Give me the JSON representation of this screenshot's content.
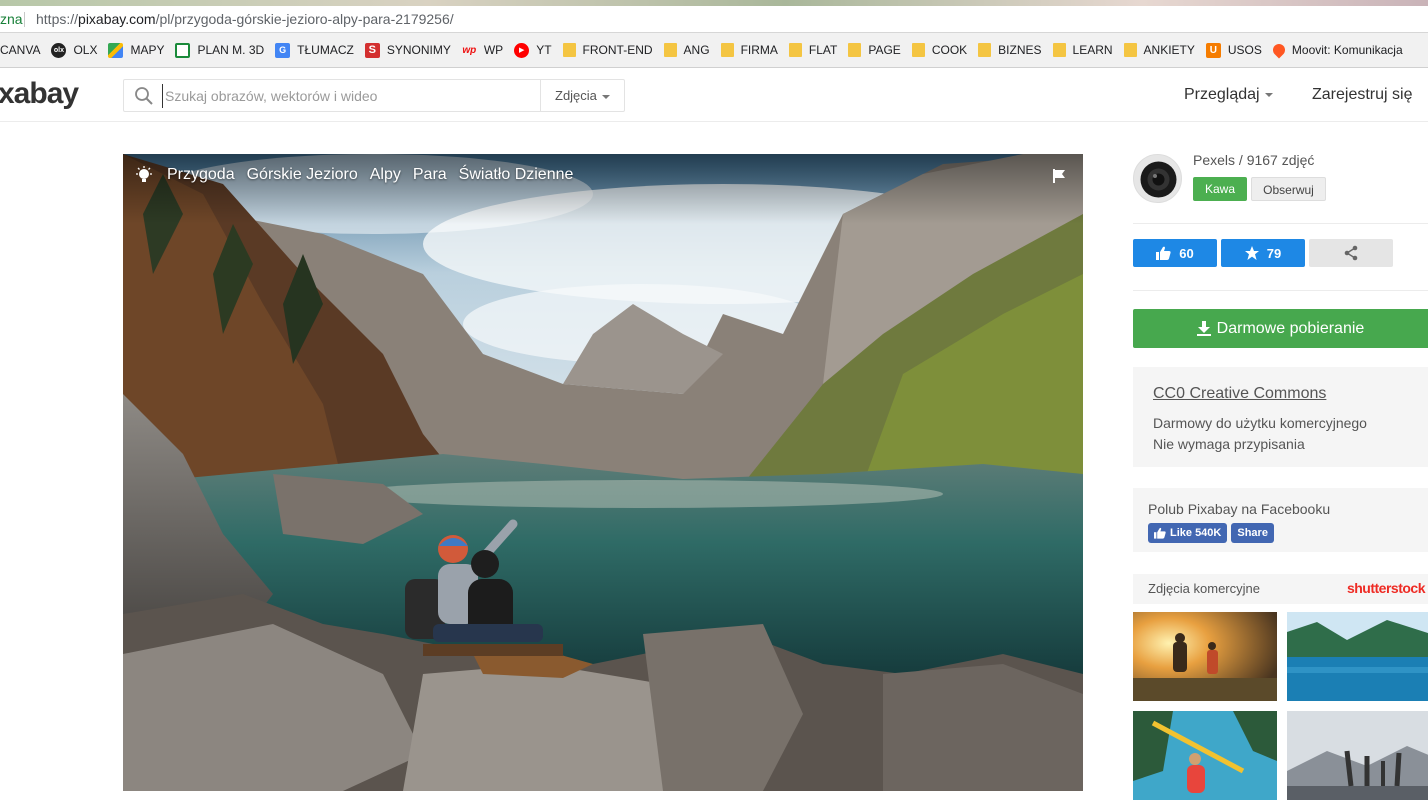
{
  "browser": {
    "url_fragment": "zna",
    "url_scheme": "https://",
    "url_host": "pixabay.com",
    "url_path": "/pl/przygoda-górskie-jezioro-alpy-para-2179256/"
  },
  "bookmarks": [
    {
      "label": "CANVA",
      "icon": "canva-icon"
    },
    {
      "label": "OLX",
      "icon": "olx-icon"
    },
    {
      "label": "MAPY",
      "icon": "maps-icon"
    },
    {
      "label": "PLAN M. 3D",
      "icon": "plan-icon"
    },
    {
      "label": "TŁUMACZ",
      "icon": "translate-icon"
    },
    {
      "label": "SYNONIMY",
      "icon": "synonyms-icon"
    },
    {
      "label": "WP",
      "icon": "wp-icon"
    },
    {
      "label": "YT",
      "icon": "youtube-icon"
    },
    {
      "label": "FRONT-END",
      "icon": "folder-icon"
    },
    {
      "label": "ANG",
      "icon": "folder-icon"
    },
    {
      "label": "FIRMA",
      "icon": "folder-icon"
    },
    {
      "label": "FLAT",
      "icon": "folder-icon"
    },
    {
      "label": "PAGE",
      "icon": "folder-icon"
    },
    {
      "label": "COOK",
      "icon": "folder-icon"
    },
    {
      "label": "BIZNES",
      "icon": "folder-icon"
    },
    {
      "label": "LEARN",
      "icon": "folder-icon"
    },
    {
      "label": "ANKIETY",
      "icon": "folder-icon"
    },
    {
      "label": "USOS",
      "icon": "usos-icon"
    },
    {
      "label": "Moovit: Komunikacja",
      "icon": "moovit-icon"
    }
  ],
  "header": {
    "logo": "xabay",
    "search_placeholder": "Szukaj obrazów, wektorów i wideo",
    "search_type": "Zdjęcia",
    "browse": "Przeglądaj",
    "register": "Zarejestruj się"
  },
  "photo": {
    "tags": [
      "Przygoda",
      "Górskie Jezioro",
      "Alpy",
      "Para",
      "Światło Dzienne"
    ]
  },
  "author": {
    "name": "Pexels / 9167 zdjęć",
    "coffee": "Kawa",
    "follow": "Obserwuj"
  },
  "stats": {
    "likes": "60",
    "favorites": "79"
  },
  "download": {
    "label": "Darmowe pobieranie"
  },
  "license": {
    "title": "CC0 Creative Commons",
    "line1": "Darmowy do użytku komercyjnego",
    "line2": "Nie wymaga przypisania"
  },
  "facebook": {
    "title": "Polub Pixabay na Facebooku",
    "like": "Like 540K",
    "share": "Share"
  },
  "commercial": {
    "title": "Zdjęcia komercyjne",
    "brand": "shutterstock"
  },
  "colors": {
    "accent_green": "#47a84e",
    "accent_blue": "#1e88e5",
    "facebook": "#4267b2",
    "shutterstock": "#ee2b24"
  }
}
